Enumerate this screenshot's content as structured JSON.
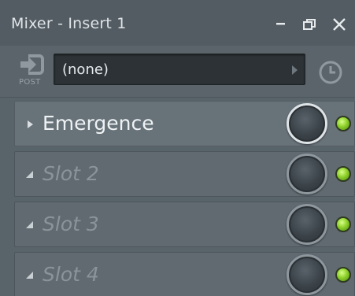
{
  "window": {
    "title": "Mixer - Insert 1",
    "controls": {
      "minimize_icon": "minimize-icon",
      "detach_icon": "detach-icon",
      "close_icon": "close-icon"
    }
  },
  "selector": {
    "post_label": "POST",
    "preset_value": "(none)",
    "history_icon": "clock-icon"
  },
  "slots": [
    {
      "label": "Emergence",
      "state": "active",
      "enabled": true
    },
    {
      "label": "Slot 2",
      "state": "empty",
      "enabled": true
    },
    {
      "label": "Slot 3",
      "state": "empty",
      "enabled": true
    },
    {
      "label": "Slot 4",
      "state": "empty",
      "enabled": true
    }
  ],
  "colors": {
    "background": "#59636a",
    "led_on": "#8fd12c",
    "preset_field": "#2c3236"
  }
}
